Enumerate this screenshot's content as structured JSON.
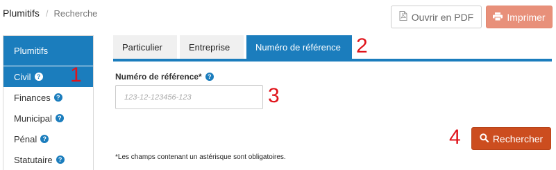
{
  "breadcrumb": {
    "home": "Plumitifs",
    "separator": "/",
    "current": "Recherche"
  },
  "toolbar": {
    "pdf_label": "Ouvrir en PDF",
    "print_label": "Imprimer"
  },
  "sidebar": {
    "title": "Plumitifs",
    "items": [
      {
        "label": "Civil",
        "active": true
      },
      {
        "label": "Finances",
        "active": false
      },
      {
        "label": "Municipal",
        "active": false
      },
      {
        "label": "Pénal",
        "active": false
      },
      {
        "label": "Statutaire",
        "active": false
      }
    ]
  },
  "tabs": [
    {
      "label": "Particulier",
      "active": false
    },
    {
      "label": "Entreprise",
      "active": false
    },
    {
      "label": "Numéro de référence",
      "active": true
    }
  ],
  "form": {
    "label": "Numéro de référence*",
    "placeholder": "123-12-123456-123",
    "value": "",
    "search_label": "Rechercher",
    "note": "*Les champs contenant un astérisque sont obligatoires."
  },
  "annotations": [
    "1",
    "2",
    "3",
    "4"
  ],
  "colors": {
    "primary": "#1b7dbd",
    "search": "#cc4d1f",
    "print": "#e8907a",
    "annotation": "#e0141b"
  }
}
